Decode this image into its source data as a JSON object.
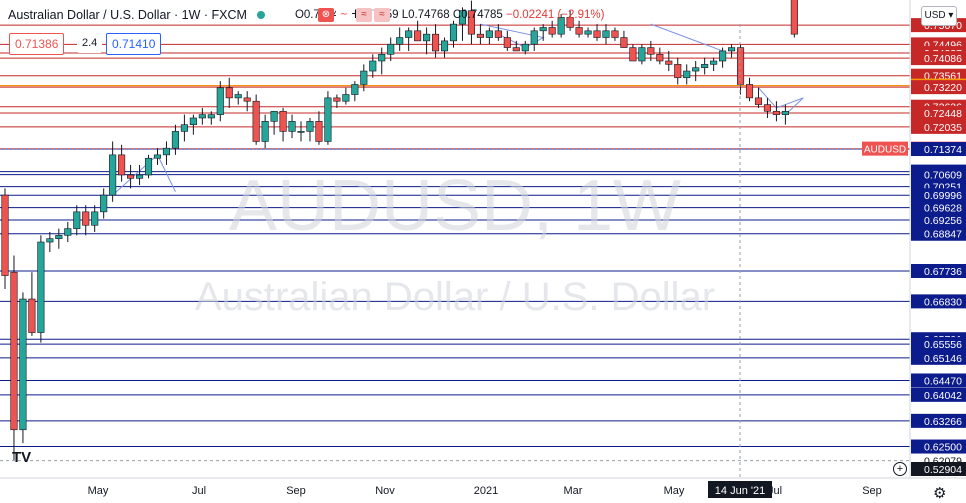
{
  "header": {
    "symbol_title": "Australian Dollar / U.S. Dollar · 1W · FXCM",
    "ohlc": {
      "open": "O0.77042",
      "high": "H0.77259",
      "low": "L0.74768",
      "close": "C0.74785",
      "change": "−0.02241 (−2.91%)"
    }
  },
  "trade": {
    "sell_price": "0.71386",
    "spread": "2.4",
    "buy_price": "0.71410"
  },
  "currency_button": "USD ▾",
  "watermark": {
    "ticker": "AUDUSD, 1W",
    "name": "Australian Dollar / U.S. Dollar"
  },
  "colors": {
    "up": "#26a69a",
    "down": "#ef5350",
    "red_level": "#c62828",
    "blue_level": "#0d1c8c",
    "orange_level": "#ff9800",
    "pattern": "#7e93e0"
  },
  "chart_data": {
    "type": "candlestick",
    "timeframe": "1W",
    "ylim": [
      0.618,
      0.757
    ],
    "price_axis_labels": [
      "0.75070",
      "0.74496",
      "0.74237",
      "0.74086",
      "0.73561",
      "0.73264",
      "0.73220",
      "0.72636",
      "0.72448",
      "0.72035",
      "0.71386",
      "0.71374",
      "0.70701",
      "0.70609",
      "0.70251",
      "0.69996",
      "0.69628",
      "0.69256",
      "0.68847",
      "0.67736",
      "0.66830",
      "0.65701",
      "0.65556",
      "0.65146",
      "0.64470",
      "0.64042",
      "0.63266",
      "0.62500",
      "0.62079",
      "0.52904"
    ],
    "time_axis_labels": [
      "May",
      "Jul",
      "Sep",
      "Nov",
      "2021",
      "Mar",
      "May",
      "14 Jun '21",
      "Jul",
      "Sep"
    ],
    "resistance_levels": [
      0.7507,
      0.74496,
      0.74237,
      0.74086,
      0.73561,
      0.73264,
      0.7322,
      0.72636,
      0.72448,
      0.72035
    ],
    "support_levels": [
      0.71374,
      0.70701,
      0.70609,
      0.70251,
      0.69996,
      0.69628,
      0.69256,
      0.68847,
      0.67736,
      0.6683,
      0.65701,
      0.65556,
      0.65146,
      0.6447,
      0.64042,
      0.63266,
      0.625
    ],
    "highlight_levels": [
      {
        "value": 0.73264,
        "color": "orange"
      }
    ],
    "current_price": {
      "label": "AUDUSD",
      "value": 0.71386
    },
    "dashed_level": 0.62079,
    "candles": [
      {
        "o": 0.7,
        "h": 0.702,
        "l": 0.672,
        "c": 0.676
      },
      {
        "o": 0.677,
        "h": 0.682,
        "l": 0.621,
        "c": 0.63
      },
      {
        "o": 0.63,
        "h": 0.671,
        "l": 0.626,
        "c": 0.669
      },
      {
        "o": 0.669,
        "h": 0.677,
        "l": 0.658,
        "c": 0.659
      },
      {
        "o": 0.659,
        "h": 0.688,
        "l": 0.656,
        "c": 0.686
      },
      {
        "o": 0.686,
        "h": 0.689,
        "l": 0.683,
        "c": 0.687
      },
      {
        "o": 0.687,
        "h": 0.69,
        "l": 0.684,
        "c": 0.688
      },
      {
        "o": 0.688,
        "h": 0.692,
        "l": 0.686,
        "c": 0.69
      },
      {
        "o": 0.69,
        "h": 0.697,
        "l": 0.688,
        "c": 0.695
      },
      {
        "o": 0.695,
        "h": 0.697,
        "l": 0.688,
        "c": 0.691
      },
      {
        "o": 0.691,
        "h": 0.697,
        "l": 0.689,
        "c": 0.695
      },
      {
        "o": 0.695,
        "h": 0.702,
        "l": 0.693,
        "c": 0.7
      },
      {
        "o": 0.7,
        "h": 0.716,
        "l": 0.698,
        "c": 0.712
      },
      {
        "o": 0.712,
        "h": 0.715,
        "l": 0.704,
        "c": 0.706
      },
      {
        "o": 0.706,
        "h": 0.709,
        "l": 0.702,
        "c": 0.705
      },
      {
        "o": 0.705,
        "h": 0.709,
        "l": 0.703,
        "c": 0.706
      },
      {
        "o": 0.706,
        "h": 0.712,
        "l": 0.705,
        "c": 0.711
      },
      {
        "o": 0.711,
        "h": 0.714,
        "l": 0.709,
        "c": 0.712
      },
      {
        "o": 0.712,
        "h": 0.716,
        "l": 0.709,
        "c": 0.714
      },
      {
        "o": 0.714,
        "h": 0.721,
        "l": 0.712,
        "c": 0.719
      },
      {
        "o": 0.719,
        "h": 0.724,
        "l": 0.716,
        "c": 0.721
      },
      {
        "o": 0.721,
        "h": 0.724,
        "l": 0.718,
        "c": 0.723
      },
      {
        "o": 0.723,
        "h": 0.726,
        "l": 0.721,
        "c": 0.724
      },
      {
        "o": 0.723,
        "h": 0.725,
        "l": 0.721,
        "c": 0.724
      },
      {
        "o": 0.724,
        "h": 0.734,
        "l": 0.722,
        "c": 0.732
      },
      {
        "o": 0.732,
        "h": 0.735,
        "l": 0.726,
        "c": 0.729
      },
      {
        "o": 0.729,
        "h": 0.731,
        "l": 0.727,
        "c": 0.73
      },
      {
        "o": 0.729,
        "h": 0.731,
        "l": 0.725,
        "c": 0.728
      },
      {
        "o": 0.728,
        "h": 0.73,
        "l": 0.715,
        "c": 0.716
      },
      {
        "o": 0.716,
        "h": 0.724,
        "l": 0.714,
        "c": 0.722
      },
      {
        "o": 0.722,
        "h": 0.725,
        "l": 0.718,
        "c": 0.725
      },
      {
        "o": 0.725,
        "h": 0.726,
        "l": 0.716,
        "c": 0.719
      },
      {
        "o": 0.719,
        "h": 0.724,
        "l": 0.717,
        "c": 0.722
      },
      {
        "o": 0.719,
        "h": 0.722,
        "l": 0.716,
        "c": 0.719
      },
      {
        "o": 0.719,
        "h": 0.723,
        "l": 0.716,
        "c": 0.722
      },
      {
        "o": 0.722,
        "h": 0.725,
        "l": 0.715,
        "c": 0.716
      },
      {
        "o": 0.716,
        "h": 0.731,
        "l": 0.715,
        "c": 0.729
      },
      {
        "o": 0.729,
        "h": 0.73,
        "l": 0.726,
        "c": 0.728
      },
      {
        "o": 0.728,
        "h": 0.732,
        "l": 0.727,
        "c": 0.73
      },
      {
        "o": 0.73,
        "h": 0.734,
        "l": 0.728,
        "c": 0.733
      },
      {
        "o": 0.733,
        "h": 0.739,
        "l": 0.731,
        "c": 0.737
      },
      {
        "o": 0.737,
        "h": 0.742,
        "l": 0.735,
        "c": 0.74
      },
      {
        "o": 0.74,
        "h": 0.744,
        "l": 0.736,
        "c": 0.742
      },
      {
        "o": 0.742,
        "h": 0.747,
        "l": 0.74,
        "c": 0.745
      },
      {
        "o": 0.745,
        "h": 0.75,
        "l": 0.743,
        "c": 0.747
      },
      {
        "o": 0.747,
        "h": 0.75,
        "l": 0.743,
        "c": 0.749
      },
      {
        "o": 0.749,
        "h": 0.752,
        "l": 0.746,
        "c": 0.746
      },
      {
        "o": 0.746,
        "h": 0.75,
        "l": 0.742,
        "c": 0.748
      },
      {
        "o": 0.748,
        "h": 0.751,
        "l": 0.741,
        "c": 0.743
      },
      {
        "o": 0.743,
        "h": 0.747,
        "l": 0.741,
        "c": 0.746
      },
      {
        "o": 0.746,
        "h": 0.752,
        "l": 0.744,
        "c": 0.751
      },
      {
        "o": 0.751,
        "h": 0.756,
        "l": 0.746,
        "c": 0.755
      },
      {
        "o": 0.755,
        "h": 0.758,
        "l": 0.745,
        "c": 0.748
      },
      {
        "o": 0.748,
        "h": 0.751,
        "l": 0.745,
        "c": 0.747
      },
      {
        "o": 0.747,
        "h": 0.75,
        "l": 0.745,
        "c": 0.749
      },
      {
        "o": 0.749,
        "h": 0.751,
        "l": 0.746,
        "c": 0.747
      },
      {
        "o": 0.747,
        "h": 0.749,
        "l": 0.743,
        "c": 0.744
      },
      {
        "o": 0.744,
        "h": 0.746,
        "l": 0.743,
        "c": 0.743
      },
      {
        "o": 0.743,
        "h": 0.746,
        "l": 0.742,
        "c": 0.745
      },
      {
        "o": 0.745,
        "h": 0.75,
        "l": 0.743,
        "c": 0.749
      },
      {
        "o": 0.749,
        "h": 0.751,
        "l": 0.746,
        "c": 0.75
      },
      {
        "o": 0.75,
        "h": 0.752,
        "l": 0.747,
        "c": 0.748
      },
      {
        "o": 0.748,
        "h": 0.754,
        "l": 0.747,
        "c": 0.753
      },
      {
        "o": 0.753,
        "h": 0.755,
        "l": 0.749,
        "c": 0.75
      },
      {
        "o": 0.75,
        "h": 0.752,
        "l": 0.747,
        "c": 0.748
      },
      {
        "o": 0.748,
        "h": 0.75,
        "l": 0.747,
        "c": 0.749
      },
      {
        "o": 0.749,
        "h": 0.751,
        "l": 0.746,
        "c": 0.747
      },
      {
        "o": 0.747,
        "h": 0.751,
        "l": 0.745,
        "c": 0.749
      },
      {
        "o": 0.749,
        "h": 0.75,
        "l": 0.746,
        "c": 0.747
      },
      {
        "o": 0.747,
        "h": 0.749,
        "l": 0.744,
        "c": 0.744
      },
      {
        "o": 0.744,
        "h": 0.745,
        "l": 0.74,
        "c": 0.74
      },
      {
        "o": 0.74,
        "h": 0.745,
        "l": 0.739,
        "c": 0.744
      },
      {
        "o": 0.744,
        "h": 0.746,
        "l": 0.74,
        "c": 0.742
      },
      {
        "o": 0.742,
        "h": 0.744,
        "l": 0.739,
        "c": 0.74
      },
      {
        "o": 0.74,
        "h": 0.743,
        "l": 0.737,
        "c": 0.739
      },
      {
        "o": 0.739,
        "h": 0.741,
        "l": 0.733,
        "c": 0.735
      },
      {
        "o": 0.735,
        "h": 0.739,
        "l": 0.733,
        "c": 0.737
      },
      {
        "o": 0.737,
        "h": 0.74,
        "l": 0.734,
        "c": 0.738
      },
      {
        "o": 0.738,
        "h": 0.741,
        "l": 0.736,
        "c": 0.739
      },
      {
        "o": 0.739,
        "h": 0.741,
        "l": 0.737,
        "c": 0.74
      },
      {
        "o": 0.74,
        "h": 0.744,
        "l": 0.738,
        "c": 0.743
      },
      {
        "o": 0.743,
        "h": 0.745,
        "l": 0.741,
        "c": 0.744
      },
      {
        "o": 0.744,
        "h": 0.745,
        "l": 0.73,
        "c": 0.733
      },
      {
        "o": 0.733,
        "h": 0.735,
        "l": 0.728,
        "c": 0.729
      },
      {
        "o": 0.729,
        "h": 0.732,
        "l": 0.726,
        "c": 0.727
      },
      {
        "o": 0.727,
        "h": 0.729,
        "l": 0.723,
        "c": 0.725
      },
      {
        "o": 0.725,
        "h": 0.728,
        "l": 0.722,
        "c": 0.724
      },
      {
        "o": 0.724,
        "h": 0.727,
        "l": 0.721,
        "c": 0.725
      },
      {
        "o": 0.77,
        "h": 0.773,
        "l": 0.747,
        "c": 0.748
      }
    ]
  }
}
